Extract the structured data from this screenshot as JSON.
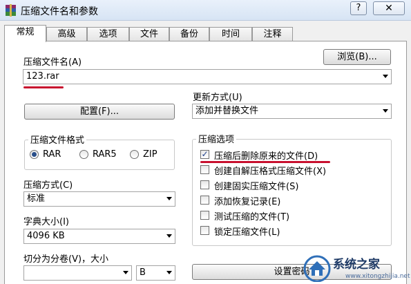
{
  "window": {
    "title": "压缩文件名和参数",
    "help_label": "?",
    "close_label": "✕"
  },
  "tabs": [
    {
      "label": "常规",
      "active": true
    },
    {
      "label": "高级"
    },
    {
      "label": "选项"
    },
    {
      "label": "文件"
    },
    {
      "label": "备份"
    },
    {
      "label": "时间"
    },
    {
      "label": "注释"
    }
  ],
  "archive": {
    "name_label": "压缩文件名(A)",
    "name_value": "123.rar",
    "browse_label": "浏览(B)...",
    "update_label": "更新方式(U)",
    "update_value": "添加并替换文件",
    "profile_label": "配置(F)..."
  },
  "format": {
    "group_title": "压缩文件格式",
    "options": [
      {
        "label": "RAR",
        "selected": true
      },
      {
        "label": "RAR5",
        "selected": false
      },
      {
        "label": "ZIP",
        "selected": false
      }
    ]
  },
  "method": {
    "label": "压缩方式(C)",
    "value": "标准"
  },
  "dictionary": {
    "label": "字典大小(I)",
    "value": "4096 KB"
  },
  "split": {
    "label": "切分为分卷(V)，大小",
    "value": "",
    "unit": "B"
  },
  "options": {
    "group_title": "压缩选项",
    "items": [
      {
        "label": "压缩后删除原来的文件(D)",
        "checked": true
      },
      {
        "label": "创建自解压格式压缩文件(X)",
        "checked": false
      },
      {
        "label": "创建固实压缩文件(S)",
        "checked": false
      },
      {
        "label": "添加恢复记录(E)",
        "checked": false
      },
      {
        "label": "测试压缩的文件(T)",
        "checked": false
      },
      {
        "label": "锁定压缩文件(L)",
        "checked": false
      }
    ]
  },
  "password_button": "设置密码",
  "watermark": {
    "text": "系统之家",
    "url": "www.xitongzhijia.net"
  },
  "colors": {
    "highlight_underline": "#c8102e",
    "check_mark": "#1c3e8a"
  }
}
